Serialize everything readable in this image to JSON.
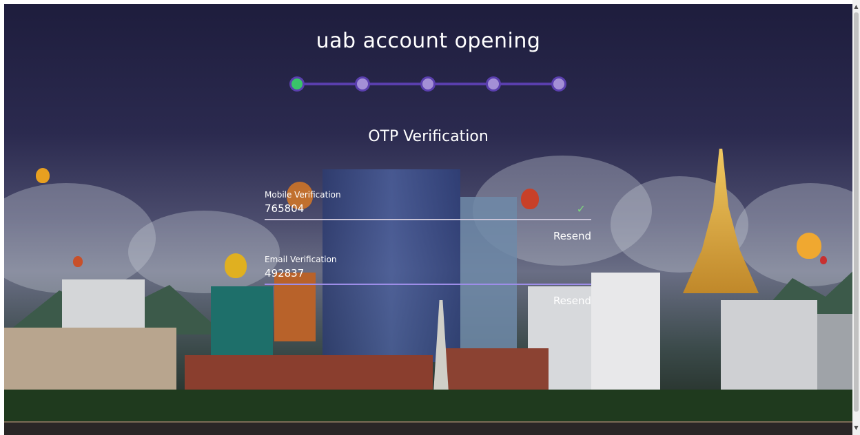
{
  "header": {
    "title": "uab account opening"
  },
  "stepper": {
    "steps": 5,
    "active_step": 1
  },
  "form": {
    "heading": "OTP Verification",
    "mobile": {
      "label": "Mobile Verification",
      "value": "765804",
      "resend_label": "Resend",
      "verified": true
    },
    "email": {
      "label": "Email Verification",
      "value": "492837",
      "resend_label": "Resend"
    }
  },
  "colors": {
    "stepper_line": "#5a3fae",
    "step_active": "#39c46a",
    "step_inactive": "#a38fd6",
    "check": "#7dd67d"
  },
  "icons": {
    "verified": "check-icon",
    "scroll_up": "chevron-up-icon",
    "scroll_down": "chevron-down-icon"
  }
}
